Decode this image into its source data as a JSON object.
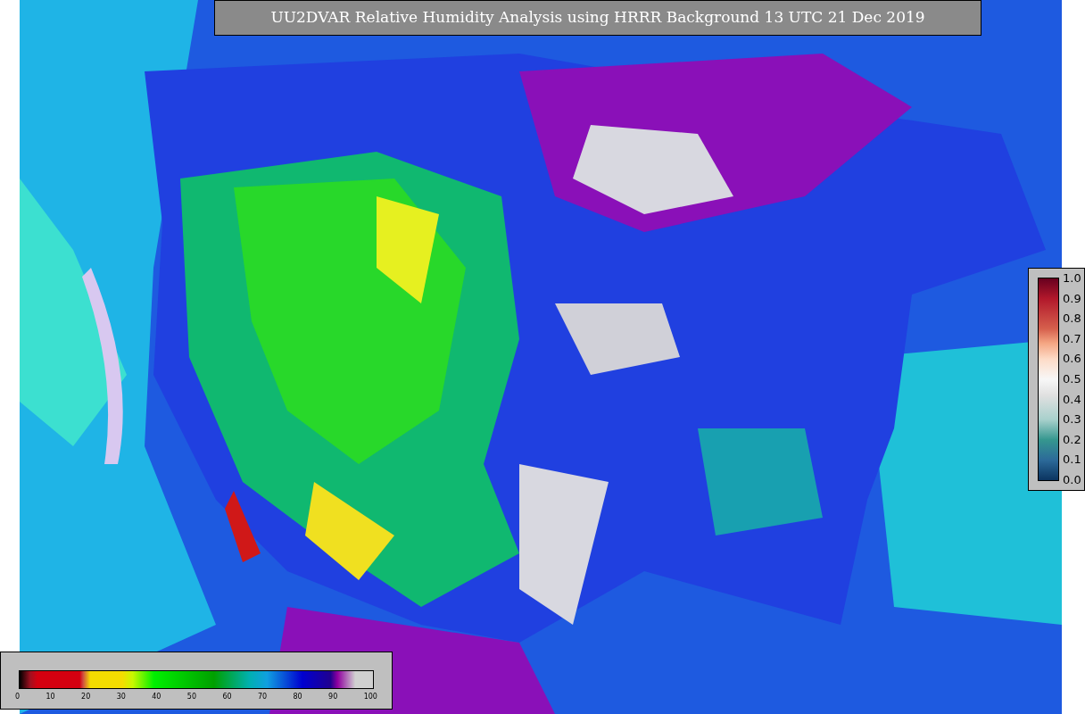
{
  "title": "UU2DVAR Relative Humidity Analysis using HRRR Background 13 UTC 21 Dec 2019",
  "fraction_scale": {
    "ticks": [
      "1.0",
      "0.9",
      "0.8",
      "0.7",
      "0.6",
      "0.5",
      "0.4",
      "0.3",
      "0.2",
      "0.1",
      "0.0"
    ]
  },
  "humidity_scale": {
    "ticks": [
      "0",
      "10",
      "20",
      "30",
      "40",
      "50",
      "60",
      "70",
      "80",
      "90",
      "100"
    ]
  }
}
